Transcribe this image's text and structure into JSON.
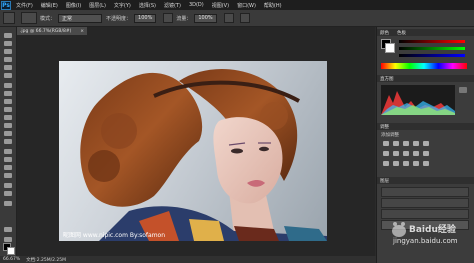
{
  "app": {
    "logo": "Ps"
  },
  "menu": [
    "文件(F)",
    "编辑(E)",
    "图像(I)",
    "图层(L)",
    "文字(Y)",
    "选择(S)",
    "滤镜(T)",
    "3D(D)",
    "视图(V)",
    "窗口(W)",
    "帮助(H)"
  ],
  "options": {
    "mode_label": "模式：",
    "mode_value": "正常",
    "opacity_label": "不透明度：",
    "opacity_value": "100%",
    "flow_label": "流量：",
    "flow_value": "100%"
  },
  "document": {
    "tab_label": ".jpg @ 66.7%(RGB/8#)",
    "close": "×"
  },
  "status": {
    "zoom": "66.67%",
    "doc_size": "文档:2.25M/2.25M"
  },
  "panels": {
    "color_tab": "颜色",
    "swatch_tab": "色板",
    "histogram_tab": "直方图",
    "adjust_tab": "调整",
    "adjust_hint": "添加调整",
    "layers_tab": "图层"
  },
  "photo_caption": "昵图网 www.nipic.com  By:sofamon",
  "watermark": {
    "brand": "Baidu经验",
    "url": "jingyan.baidu.com"
  },
  "colors": {
    "accent": "#31a8ff",
    "bg": "#2b2b2b",
    "panel": "#3c3c3c"
  },
  "icons": [
    "ps-logo-icon",
    "brush-tool-icon",
    "close-icon",
    "gear-icon"
  ]
}
